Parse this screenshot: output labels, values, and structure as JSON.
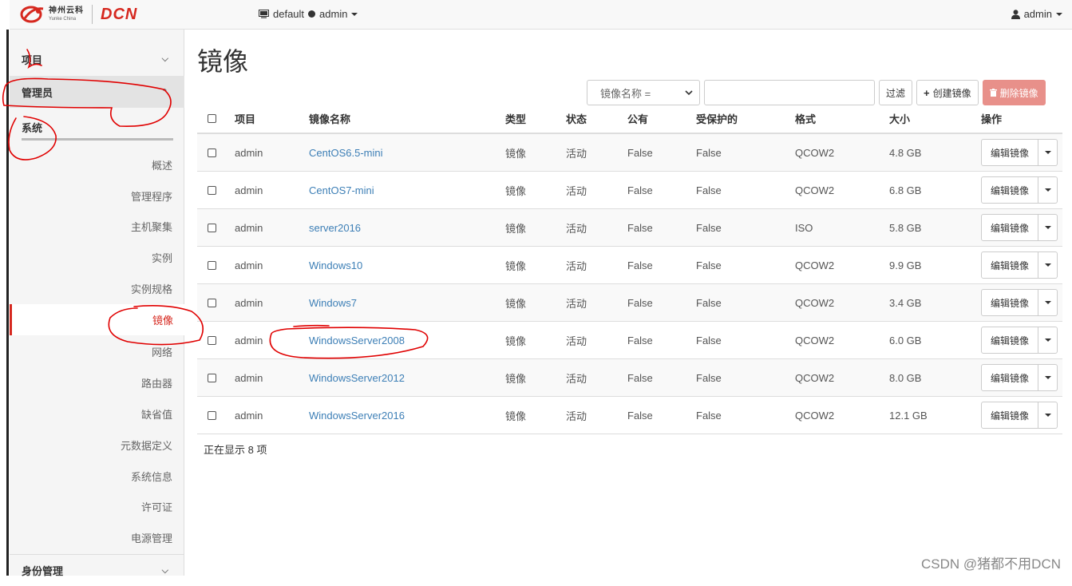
{
  "brand": {
    "cn_name": "神州云科",
    "en_name": "Yunke China",
    "product": "DCN"
  },
  "topbar": {
    "project": "default",
    "project_user": "admin",
    "user": "admin"
  },
  "sidebar": {
    "sections": {
      "project": "项目",
      "admin": "管理员",
      "system": "系统",
      "identity": "身份管理"
    },
    "items": [
      "概述",
      "管理程序",
      "主机聚集",
      "实例",
      "实例规格",
      "镜像",
      "网络",
      "路由器",
      "缺省值",
      "元数据定义",
      "系统信息",
      "许可证",
      "电源管理"
    ],
    "current_item": "镜像"
  },
  "page": {
    "title": "镜像"
  },
  "toolbar": {
    "filter_field": "镜像名称 =",
    "filter_value": "",
    "filter_button": "过滤",
    "create_button": "创建镜像",
    "delete_button": "删除镜像"
  },
  "table": {
    "headers": {
      "project": "项目",
      "name": "镜像名称",
      "type": "类型",
      "status": "状态",
      "public": "公有",
      "protected": "受保护的",
      "format": "格式",
      "size": "大小",
      "actions": "操作"
    },
    "rows": [
      {
        "project": "admin",
        "name": "CentOS6.5-mini",
        "type": "镜像",
        "status": "活动",
        "public": "False",
        "protected": "False",
        "format": "QCOW2",
        "size": "4.8 GB",
        "action": "编辑镜像"
      },
      {
        "project": "admin",
        "name": "CentOS7-mini",
        "type": "镜像",
        "status": "活动",
        "public": "False",
        "protected": "False",
        "format": "QCOW2",
        "size": "6.8 GB",
        "action": "编辑镜像"
      },
      {
        "project": "admin",
        "name": "server2016",
        "type": "镜像",
        "status": "活动",
        "public": "False",
        "protected": "False",
        "format": "ISO",
        "size": "5.8 GB",
        "action": "编辑镜像"
      },
      {
        "project": "admin",
        "name": "Windows10",
        "type": "镜像",
        "status": "活动",
        "public": "False",
        "protected": "False",
        "format": "QCOW2",
        "size": "9.9 GB",
        "action": "编辑镜像"
      },
      {
        "project": "admin",
        "name": "Windows7",
        "type": "镜像",
        "status": "活动",
        "public": "False",
        "protected": "False",
        "format": "QCOW2",
        "size": "3.4 GB",
        "action": "编辑镜像"
      },
      {
        "project": "admin",
        "name": "WindowsServer2008",
        "type": "镜像",
        "status": "活动",
        "public": "False",
        "protected": "False",
        "format": "QCOW2",
        "size": "6.0 GB",
        "action": "编辑镜像"
      },
      {
        "project": "admin",
        "name": "WindowsServer2012",
        "type": "镜像",
        "status": "活动",
        "public": "False",
        "protected": "False",
        "format": "QCOW2",
        "size": "8.0 GB",
        "action": "编辑镜像"
      },
      {
        "project": "admin",
        "name": "WindowsServer2016",
        "type": "镜像",
        "status": "活动",
        "public": "False",
        "protected": "False",
        "format": "QCOW2",
        "size": "12.1 GB",
        "action": "编辑镜像"
      }
    ],
    "footer": "正在显示 8 项"
  },
  "watermark": "CSDN @猪都不用DCN",
  "colors": {
    "brand_red": "#d6281f",
    "link": "#3d7fb6",
    "annotation": "#e00000"
  }
}
